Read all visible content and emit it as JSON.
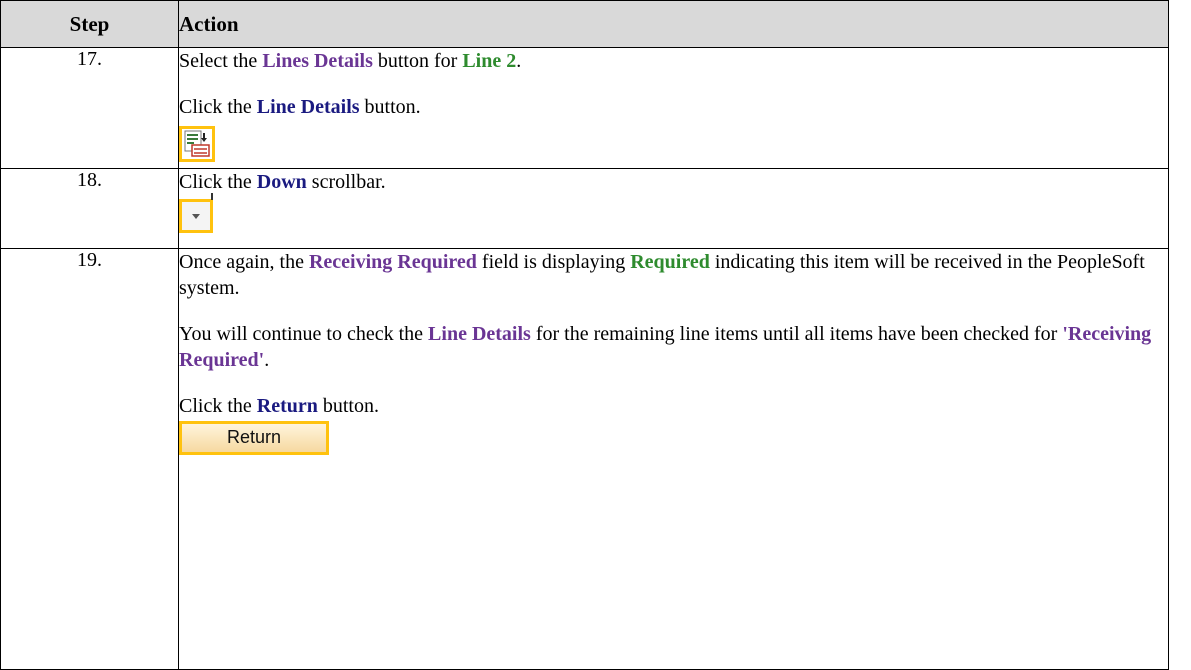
{
  "header": {
    "step": "Step",
    "action": "Action"
  },
  "rows": [
    {
      "step": "17.",
      "p1": {
        "a": "Select the ",
        "b": "Lines Details",
        "c": " button for ",
        "d": "Line 2",
        "e": "."
      },
      "p2": {
        "a": "Click the ",
        "b": "Line Details",
        "c": " button."
      },
      "icon": "line-details-icon"
    },
    {
      "step": "18.",
      "p1": {
        "a": "Click the ",
        "b": "Down",
        "c": " scrollbar."
      },
      "icon": "chevron-down-icon"
    },
    {
      "step": "19.",
      "p1": {
        "a": "Once again, the ",
        "b": "Receiving Required",
        "c": " field is displaying ",
        "d": "Required",
        "e": " indicating this item will be received in the PeopleSoft system."
      },
      "p2": {
        "a": "You will continue to check the ",
        "b": "Line Details",
        "c": " for the remaining line items until all items have been checked for ",
        "d": "'Receiving Required'",
        "e": "."
      },
      "p3": {
        "a": "Click the ",
        "b": "Return",
        "c": " button."
      },
      "button_label": "Return"
    }
  ],
  "colors": {
    "highlight": "#ffc20e",
    "ui_name": "#6a3594",
    "action_target": "#1a1a80",
    "value": "#2e8b2e",
    "header_bg": "#d9d9d9"
  }
}
